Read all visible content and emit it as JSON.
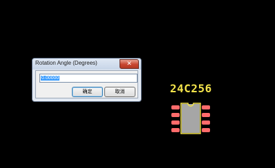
{
  "dialog": {
    "title": "Rotation Angle (Degrees)",
    "close_glyph": "✕",
    "angle_value": "0.00000",
    "ok_label": "确定",
    "cancel_label": "取消"
  },
  "canvas": {
    "component_label": "24C256",
    "colors": {
      "background": "#000000",
      "outline": "#f2e24a",
      "pads": "#ff6b6b",
      "body": "#a6a6a6"
    }
  }
}
